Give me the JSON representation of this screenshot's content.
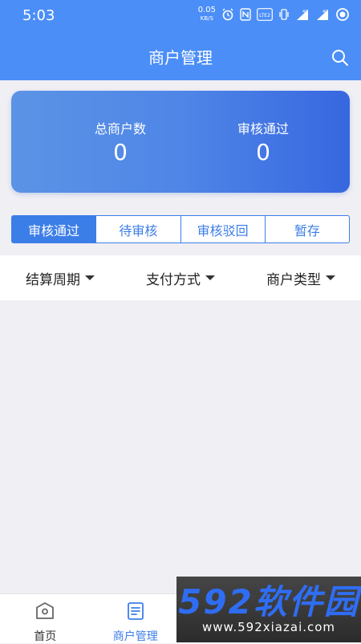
{
  "status_bar": {
    "time": "5:03",
    "net_speed": "0.05",
    "net_unit": "KB/S",
    "volte": "LTE 2",
    "signal1": "4G",
    "signal2": "4G"
  },
  "header": {
    "title": "商户管理"
  },
  "summary": {
    "total_label": "总商户数",
    "total_value": "0",
    "approved_label": "审核通过",
    "approved_value": "0"
  },
  "tabs": [
    {
      "label": "审核通过",
      "active": true
    },
    {
      "label": "待审核",
      "active": false
    },
    {
      "label": "审核驳回",
      "active": false
    },
    {
      "label": "暂存",
      "active": false
    }
  ],
  "filters": [
    {
      "label": "结算周期"
    },
    {
      "label": "支付方式"
    },
    {
      "label": "商户类型"
    }
  ],
  "bottom_nav": [
    {
      "label": "首页",
      "icon": "home-icon",
      "active": false
    },
    {
      "label": "商户管理",
      "icon": "merchant-list-icon",
      "active": true
    }
  ],
  "watermark": {
    "brand": "592软件园",
    "url": "www.592xiazai.com"
  },
  "colors": {
    "primary": "#4b8ef7",
    "tab_accent": "#3c7ee8"
  }
}
